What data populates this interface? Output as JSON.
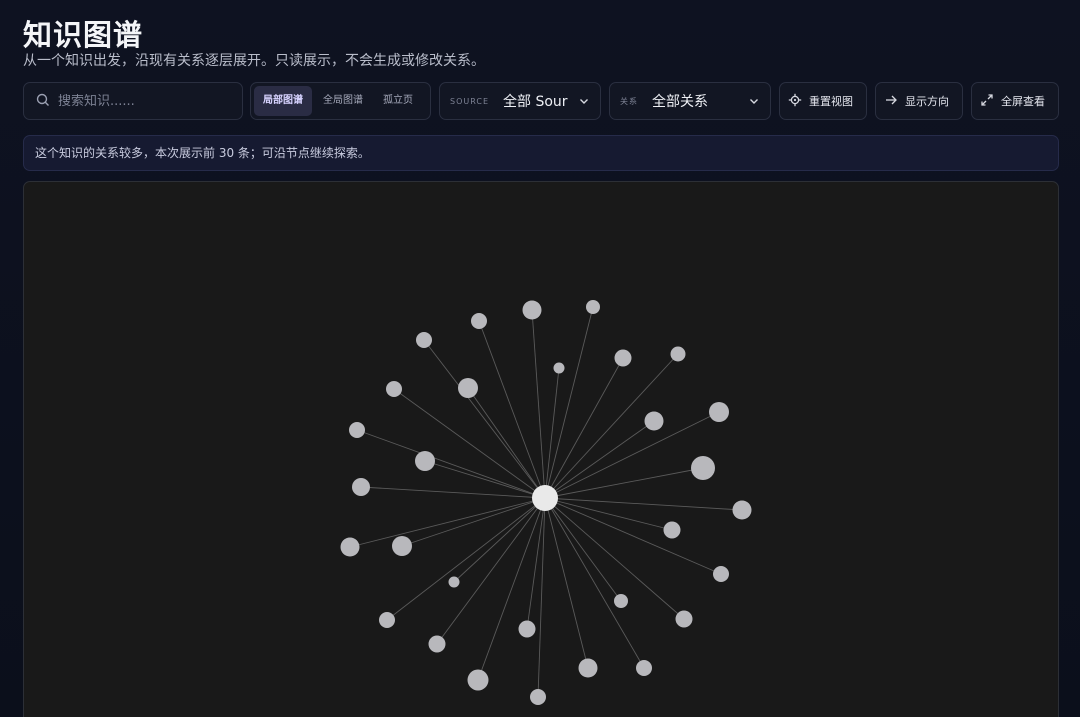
{
  "header": {
    "title": "知识图谱",
    "subtitle": "从一个知识出发，沿现有关系逐层展开。只读展示，不会生成或修改关系。"
  },
  "toolbar": {
    "search_placeholder": "搜索知识......",
    "view_modes": [
      {
        "label": "局部图谱",
        "active": true
      },
      {
        "label": "全局图谱",
        "active": false
      },
      {
        "label": "孤立页",
        "active": false
      }
    ],
    "source_filter": {
      "tag": "SOURCE",
      "value": "全部 Sour"
    },
    "relation_filter": {
      "tag": "关系",
      "value": "全部关系"
    },
    "reset_label": "重置视图",
    "direction_label": "显示方向",
    "fullscreen_label": "全屏查看"
  },
  "notice": "这个知识的关系较多，本次展示前 30 条；可沿节点继续探索。",
  "graph": {
    "center_color": "#e9e9e9",
    "node_color": "#b8b8bc",
    "edge_color": "#5a5a5a"
  }
}
